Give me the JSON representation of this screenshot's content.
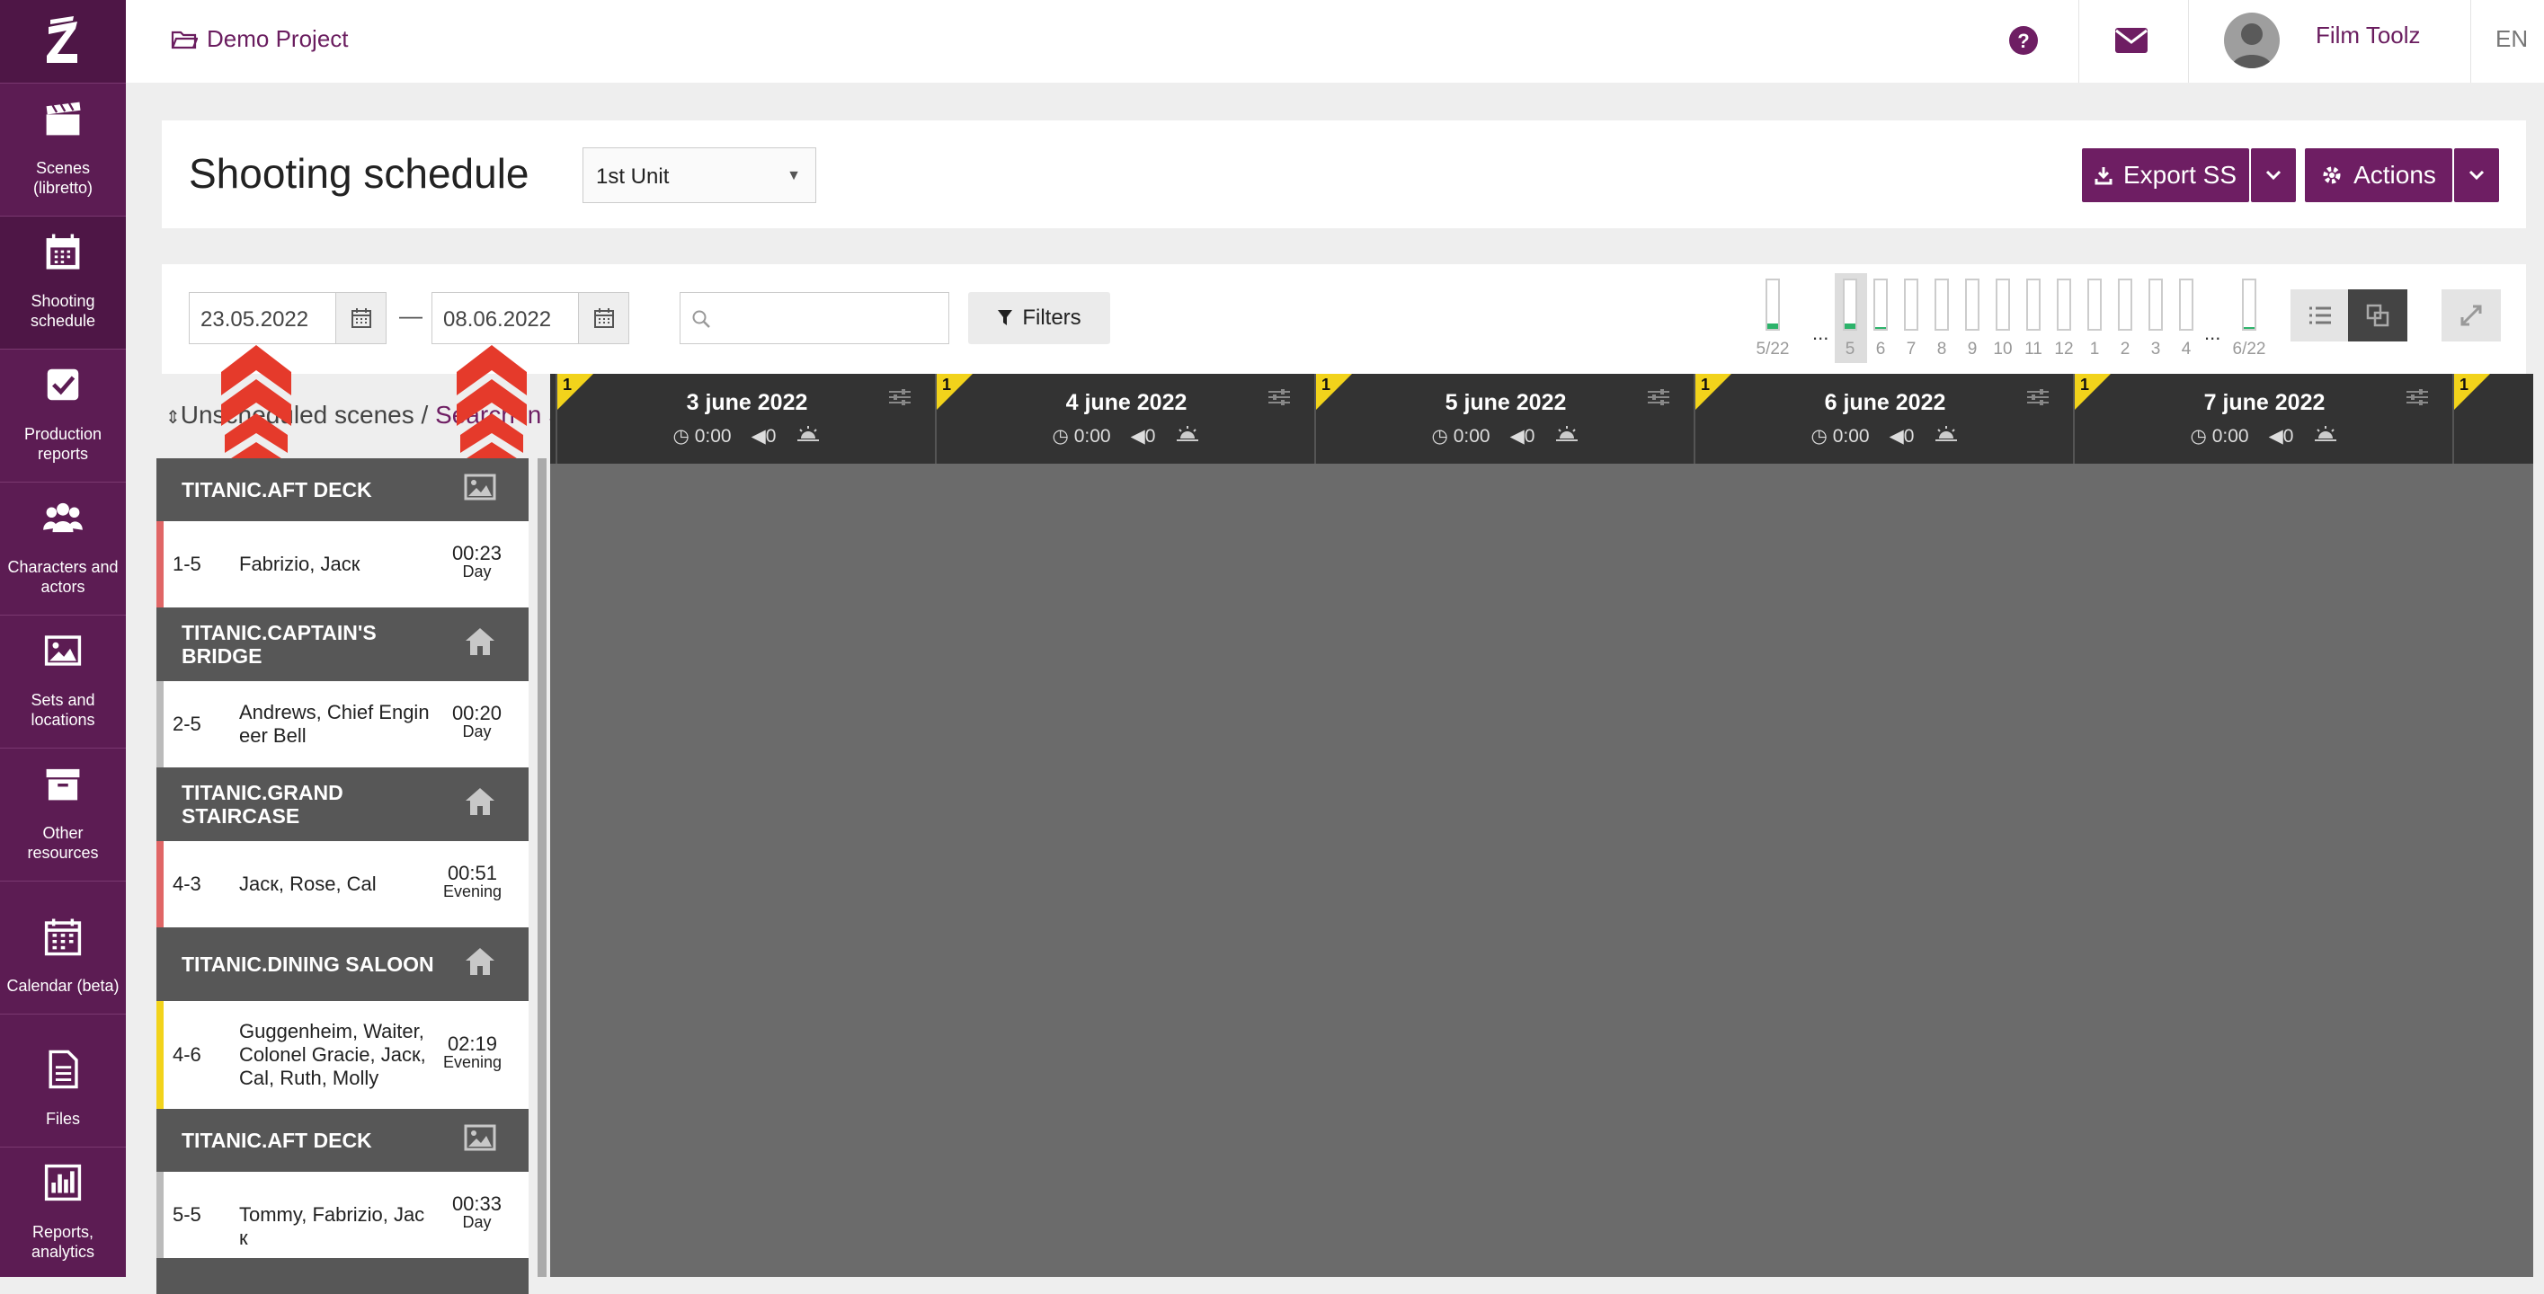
{
  "colors": {
    "brand": "#6e1e63",
    "nav_bg": "#5c1c53",
    "scene_day": "#e06666",
    "scene_gray": "#bbbbbb",
    "scene_yellow": "#f2d31b",
    "day_corner": "#f2d31b"
  },
  "nav": {
    "logo": "Z",
    "items": [
      {
        "label": "Scenes (libretto)",
        "icon": "clapperboard-icon"
      },
      {
        "label": "Shooting schedule",
        "icon": "calendar-icon",
        "active": true
      },
      {
        "label": "Production reports",
        "icon": "checkbox-icon"
      },
      {
        "label": "Characters and actors",
        "icon": "users-icon"
      },
      {
        "label": "Sets and locations",
        "icon": "image-icon"
      },
      {
        "label": "Other resources",
        "icon": "archive-icon"
      },
      {
        "label": "Calendar (beta)",
        "icon": "calendar-grid-icon"
      },
      {
        "label": "Files",
        "icon": "file-icon"
      },
      {
        "label": "Reports, analytics",
        "icon": "bar-chart-icon"
      }
    ]
  },
  "header": {
    "project": "Demo Project",
    "user": "Film Toolz",
    "language": "EN"
  },
  "page": {
    "title": "Shooting schedule",
    "unit": "1st Unit",
    "export_label": "Export SS",
    "actions_label": "Actions"
  },
  "toolbar": {
    "date_from": "23.05.2022",
    "date_sep": "—",
    "date_to": "08.06.2022",
    "search_value": "",
    "filters_label": "Filters",
    "mini_days": [
      {
        "label": "5/22",
        "fill": 0.12
      },
      {
        "label": "...",
        "dots": true
      },
      {
        "label": "5",
        "fill": 0.12,
        "selected": true
      },
      {
        "label": "6",
        "fill": 0.04
      },
      {
        "label": "7",
        "fill": 0
      },
      {
        "label": "8",
        "fill": 0
      },
      {
        "label": "9",
        "fill": 0
      },
      {
        "label": "10",
        "fill": 0
      },
      {
        "label": "11",
        "fill": 0
      },
      {
        "label": "12",
        "fill": 0
      },
      {
        "label": "1",
        "fill": 0
      },
      {
        "label": "2",
        "fill": 0
      },
      {
        "label": "3",
        "fill": 0
      },
      {
        "label": "4",
        "fill": 0
      },
      {
        "label": "...",
        "dots": true
      },
      {
        "label": "6/22",
        "fill": 0.04
      }
    ]
  },
  "list": {
    "unscheduled_label": "Unscheduled scenes",
    "separator": "/",
    "search_link": "Search in SS",
    "items": [
      {
        "kind": "group",
        "title": "TITANIC.AFT DECK",
        "icon": "image-icon"
      },
      {
        "kind": "scene",
        "num": "1-5",
        "names": "Fabrizio, Jacк",
        "time": "00:23",
        "period": "Day",
        "color": "#e06666"
      },
      {
        "kind": "group",
        "title": "TITANIC.CAPTAIN'S BRIDGE",
        "icon": "home-icon"
      },
      {
        "kind": "scene",
        "num": "2-5",
        "names": "Andrews, Chief Engin eer Bell",
        "time": "00:20",
        "period": "Day",
        "color": "#bbbbbb"
      },
      {
        "kind": "group",
        "title": "TITANIC.GRAND STAIRCASE",
        "icon": "home-icon"
      },
      {
        "kind": "scene",
        "num": "4-3",
        "names": "Jacк, Rose, Cal",
        "time": "00:51",
        "period": "Evening",
        "color": "#e06666"
      },
      {
        "kind": "group",
        "title": "TITANIC.DINING SALOON",
        "icon": "home-icon"
      },
      {
        "kind": "scene",
        "num": "4-6",
        "names": "Guggenheim, Waiter, Colonel Gracie, Jacк, Cal, Ruth, Molly",
        "time": "02:19",
        "period": "Evening",
        "color": "#f2d31b"
      },
      {
        "kind": "group",
        "title": "TITANIC.AFT DECK",
        "icon": "image-icon"
      },
      {
        "kind": "scene",
        "num": "5-5",
        "names": "Tommy, Fabrizio, Jac к",
        "time": "00:33",
        "period": "Day",
        "color": "#bbbbbb"
      }
    ]
  },
  "days": [
    {
      "date": "3 june 2022",
      "count": "1",
      "time": "0:00",
      "ads": "0"
    },
    {
      "date": "4 june 2022",
      "count": "1",
      "time": "0:00",
      "ads": "0"
    },
    {
      "date": "5 june 2022",
      "count": "1",
      "time": "0:00",
      "ads": "0"
    },
    {
      "date": "6 june 2022",
      "count": "1",
      "time": "0:00",
      "ads": "0"
    },
    {
      "date": "7 june 2022",
      "count": "1",
      "time": "0:00",
      "ads": "0"
    },
    {
      "date": "",
      "count": "1",
      "time": "",
      "ads": ""
    }
  ]
}
